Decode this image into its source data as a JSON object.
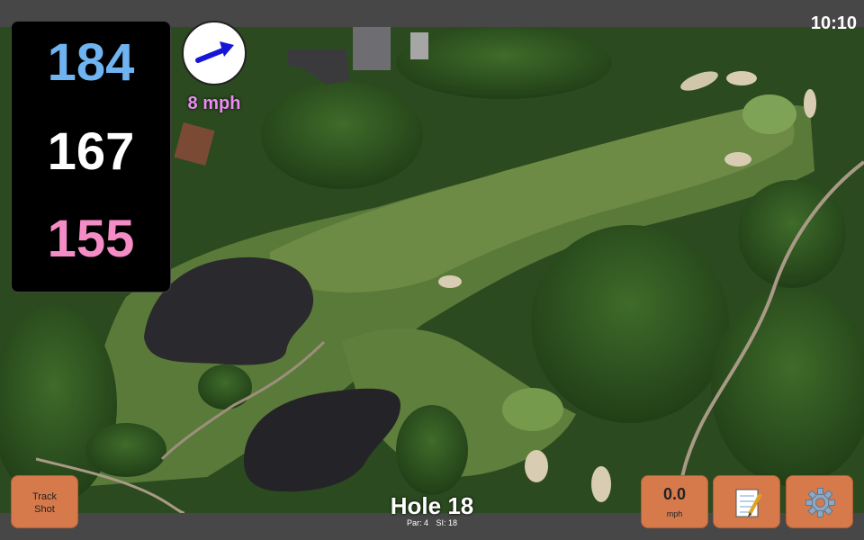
{
  "status": {
    "clock": "10:10"
  },
  "yardages": {
    "back": "184",
    "middle": "167",
    "front": "155"
  },
  "wind": {
    "speed_label": "8 mph",
    "icon": "wind-direction-arrow-icon"
  },
  "hole": {
    "title": "Hole 18",
    "par": "Par: 4",
    "stroke_index": "SI: 18"
  },
  "buttons": {
    "track_shot": {
      "line1": "Track",
      "line2": "Shot"
    },
    "speed": {
      "value": "0.0",
      "unit": "mph"
    },
    "scorecard_icon": "notepad-icon",
    "settings_icon": "gear-icon"
  },
  "colors": {
    "back": "#6fb4f0",
    "middle": "#ffffff",
    "front": "#f58cc6",
    "wind_text": "#ea8cf0",
    "button": "#d67a4c",
    "arrow": "#1616d8"
  }
}
